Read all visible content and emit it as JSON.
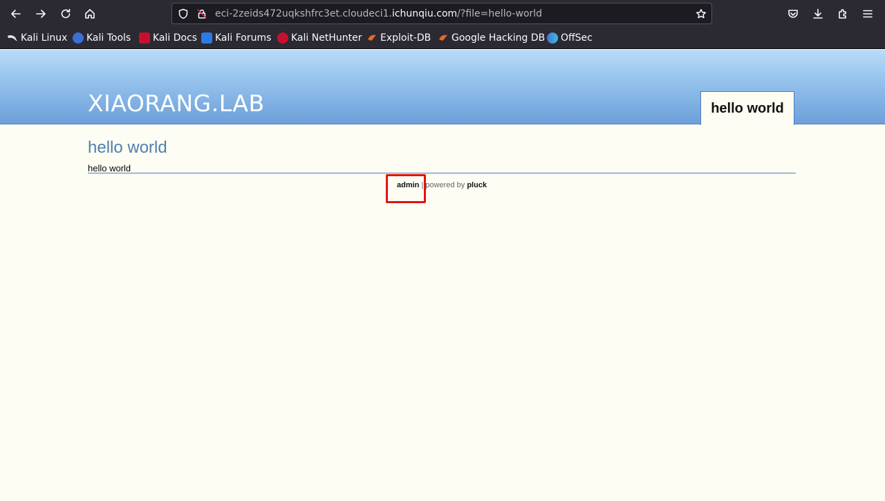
{
  "browser": {
    "url_prefix": "eci-2zeids472uqkshfrc3et.cloudeci1.",
    "url_host": "ichunqiu.com",
    "url_suffix": "/?file=hello-world",
    "bookmarks": [
      {
        "label": "Kali Linux",
        "icon": "kali-dragon-icon",
        "color": "#1b1b1b"
      },
      {
        "label": "Kali Tools",
        "icon": "kali-tools-icon",
        "color": "#3b6fd6"
      },
      {
        "label": "Kali Docs",
        "icon": "kali-docs-icon",
        "color": "#c8102e"
      },
      {
        "label": "Kali Forums",
        "icon": "kali-forums-icon",
        "color": "#2d7be5"
      },
      {
        "label": "Kali NetHunter",
        "icon": "kali-nethunter-icon",
        "color": "#c8102e"
      },
      {
        "label": "Exploit-DB",
        "icon": "exploit-db-icon",
        "color": "#e86a1f"
      },
      {
        "label": "Google Hacking DB",
        "icon": "ghdb-icon",
        "color": "#e86a1f"
      },
      {
        "label": "OffSec",
        "icon": "offsec-icon",
        "color": "#4a6fd6"
      }
    ]
  },
  "site": {
    "title": "XIAORANG.LAB",
    "menu_tab": "hello world",
    "page_title": "hello world",
    "page_body": "hello world"
  },
  "footer": {
    "admin_link": "admin",
    "separator": " | ",
    "powered_by": "powered by ",
    "pluck_link": "pluck"
  },
  "colors": {
    "highlight": "#e0140e",
    "header_top": "#b9dcf8",
    "header_bottom": "#6d9fd9",
    "page_title": "#4f7fae"
  }
}
